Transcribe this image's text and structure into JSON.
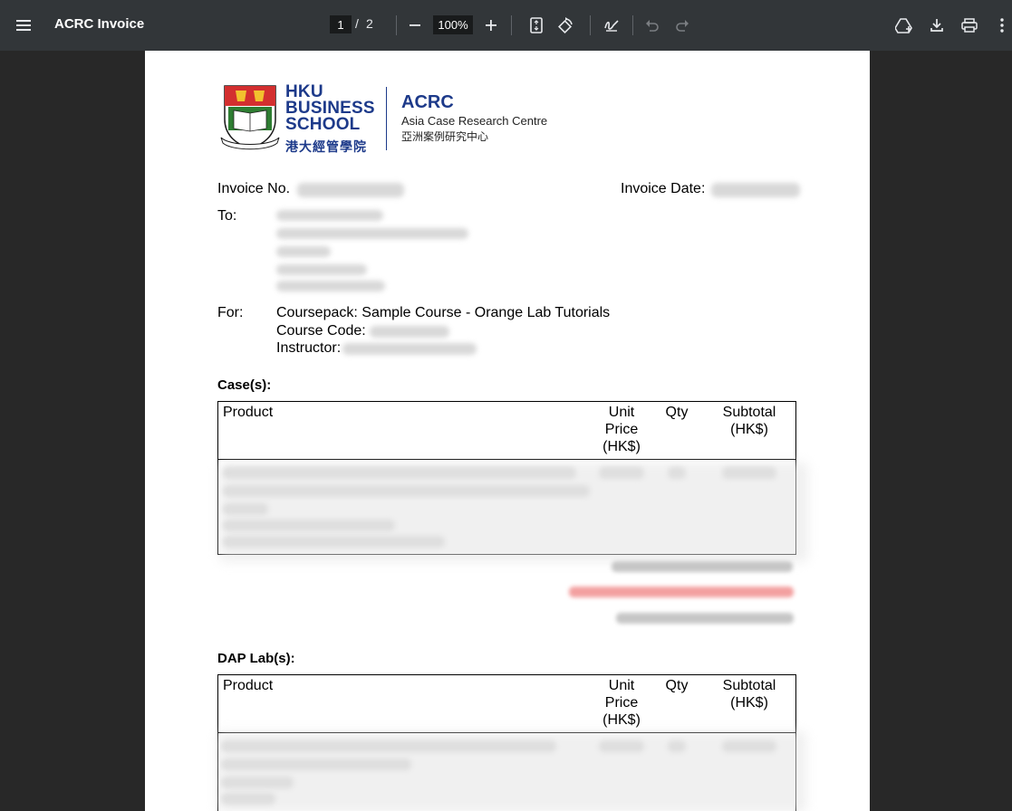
{
  "toolbar": {
    "title": "ACRC Invoice",
    "page_current": "1",
    "page_sep": "/",
    "page_total": "2",
    "zoom": "100%",
    "icons": [
      "menu-icon",
      "zoom-out-icon",
      "zoom-in-icon",
      "fit-page-icon",
      "rotate-icon",
      "annotate-icon",
      "undo-icon",
      "redo-icon",
      "save-to-drive-icon",
      "download-icon",
      "print-icon",
      "more-icon"
    ]
  },
  "logo": {
    "school_line1": "HKU",
    "school_line2": "BUSINESS",
    "school_line3": "SCHOOL",
    "school_chinese": "港大經管學院",
    "centre_abbr": "ACRC",
    "centre_name": "Asia Case Research Centre",
    "centre_chinese": "亞洲案例研究中心"
  },
  "invoice": {
    "invoice_no_label": "Invoice No.",
    "invoice_date_label": "Invoice Date:",
    "to_label": "To:",
    "for_label": "For:",
    "coursepack": "Coursepack: Sample Course - Orange Lab Tutorials",
    "course_code_label": "Course Code:",
    "instructor_label": "Instructor:"
  },
  "cases": {
    "heading": "Case(s):",
    "columns": [
      "Product",
      "Unit\nPrice\n(HK$)",
      "Qty",
      "Subtotal\n(HK$)"
    ]
  },
  "labs": {
    "heading": "DAP Lab(s):",
    "columns": [
      "Product",
      "Unit\nPrice\n(HK$)",
      "Qty",
      "Subtotal\n(HK$)"
    ]
  },
  "colors": {
    "toolbar_bg": "#323639",
    "viewer_bg": "#282828",
    "brand_blue": "#1d3a8a",
    "discount_red": "#e53935"
  }
}
